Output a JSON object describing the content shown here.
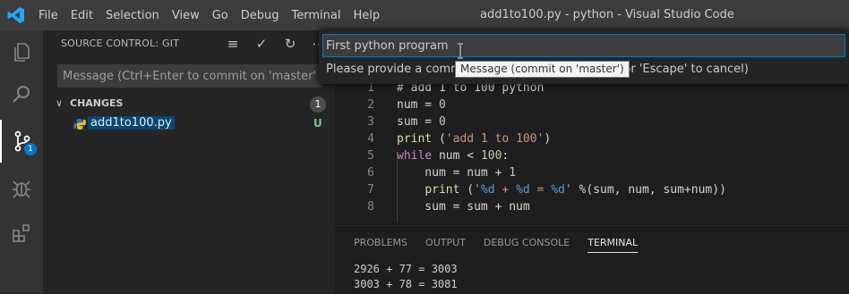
{
  "window": {
    "title": "add1to100.py - python - Visual Studio Code"
  },
  "menu": [
    "File",
    "Edit",
    "Selection",
    "View",
    "Go",
    "Debug",
    "Terminal",
    "Help"
  ],
  "activity_bar": {
    "icons": [
      "files-icon",
      "search-icon",
      "source-control-icon",
      "debug-icon",
      "extensions-icon"
    ],
    "source_control_badge": "1"
  },
  "sidebar": {
    "header": "SOURCE CONTROL: GIT",
    "commit_placeholder": "Message (Ctrl+Enter to commit on 'master')",
    "changes_label": "CHANGES",
    "changes_count": "1",
    "file": {
      "name": "add1to100.py",
      "status": "U"
    }
  },
  "quick_input": {
    "value": "First python program",
    "prompt": "Please provide a commit message (Press 'Enter' to confirm or 'Escape' to cancel)",
    "prompt_visible_left": "Please provide a commit",
    "prompt_visible_right": "rm or 'Escape' to cancel)",
    "tooltip": "Message (commit on 'master')"
  },
  "editor": {
    "lines": [
      {
        "n": "1",
        "text": "# add 1 to 100 python"
      },
      {
        "n": "2",
        "text": "num = 0"
      },
      {
        "n": "3",
        "text": "sum = 0"
      },
      {
        "n": "4",
        "text": "print ('add 1 to 100')"
      },
      {
        "n": "5",
        "text": "while num < 100:"
      },
      {
        "n": "6",
        "text": "    num = num + 1"
      },
      {
        "n": "7",
        "text": "    print ('%d + %d = %d' %(sum, num, sum+num))"
      },
      {
        "n": "8",
        "text": "    sum = sum + num"
      }
    ]
  },
  "panel": {
    "tabs": [
      "PROBLEMS",
      "OUTPUT",
      "DEBUG CONSOLE",
      "TERMINAL"
    ],
    "active_tab": "TERMINAL",
    "terminal_lines": [
      "2926 + 77 = 3003",
      "3003 + 78 = 3081"
    ]
  },
  "colors": {
    "accent": "#007acc",
    "selection": "#094771",
    "untracked": "#73c991"
  }
}
